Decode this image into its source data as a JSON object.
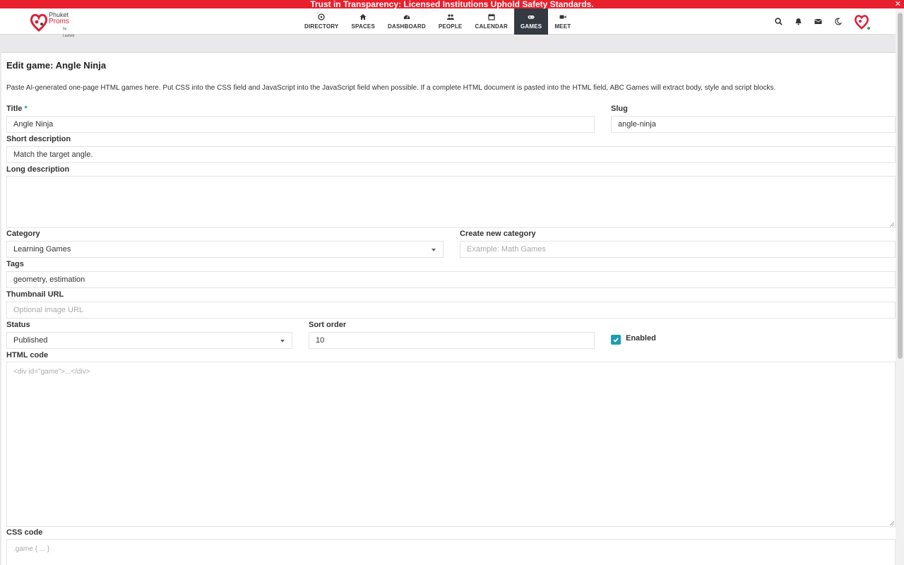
{
  "banner": {
    "text": "Trust in Transparency: Licensed Institutions Uphold Safety Standards.",
    "close": "✕"
  },
  "brand": {
    "line1": "Phuket",
    "line2": "Proms",
    "line3": "by Lasheb",
    "color": "#d9233a"
  },
  "nav": {
    "items": [
      {
        "label": "DIRECTORY",
        "icon": "compass-icon"
      },
      {
        "label": "SPACES",
        "icon": "home-icon"
      },
      {
        "label": "DASHBOARD",
        "icon": "dashboard-icon"
      },
      {
        "label": "PEOPLE",
        "icon": "users-icon"
      },
      {
        "label": "CALENDAR",
        "icon": "calendar-icon"
      },
      {
        "label": "GAMES",
        "icon": "gamepad-icon",
        "active": true
      },
      {
        "label": "MEET",
        "icon": "video-icon"
      }
    ],
    "active_color": "#333a42"
  },
  "header_icons": [
    "search-icon",
    "bell-icon",
    "envelope-icon",
    "moon-icon"
  ],
  "form": {
    "title": "Edit game: Angle Ninja",
    "intro": "Paste AI-generated one-page HTML games here. Put CSS into the CSS field and JavaScript into the JavaScript field when possible. If a complete HTML document is pasted into the HTML field, ABC Games will extract body, style and script blocks.",
    "title_label": "Title",
    "required_mark": "*",
    "title_value": "Angle Ninja",
    "slug_label": "Slug",
    "slug_value": "angle-ninja",
    "short_label": "Short description",
    "short_value": "Match the target angle.",
    "long_label": "Long description",
    "long_value": "",
    "category_label": "Category",
    "category_value": "Learning Games",
    "newcat_label": "Create new category",
    "newcat_placeholder": "Example: Math Games",
    "tags_label": "Tags",
    "tags_value": "geometry, estimation",
    "thumb_label": "Thumbnail URL",
    "thumb_placeholder": "Optional image URL",
    "status_label": "Status",
    "status_value": "Published",
    "sort_label": "Sort order",
    "sort_value": "10",
    "enabled_label": "Enabled",
    "enabled_checked": true,
    "html_label": "HTML code",
    "html_placeholder": "<div id=\"game\">...</div>",
    "css_label": "CSS code",
    "css_placeholder": ".game { ... }"
  },
  "colors": {
    "accent": "#1e9db2",
    "banner": "#e8202d"
  }
}
